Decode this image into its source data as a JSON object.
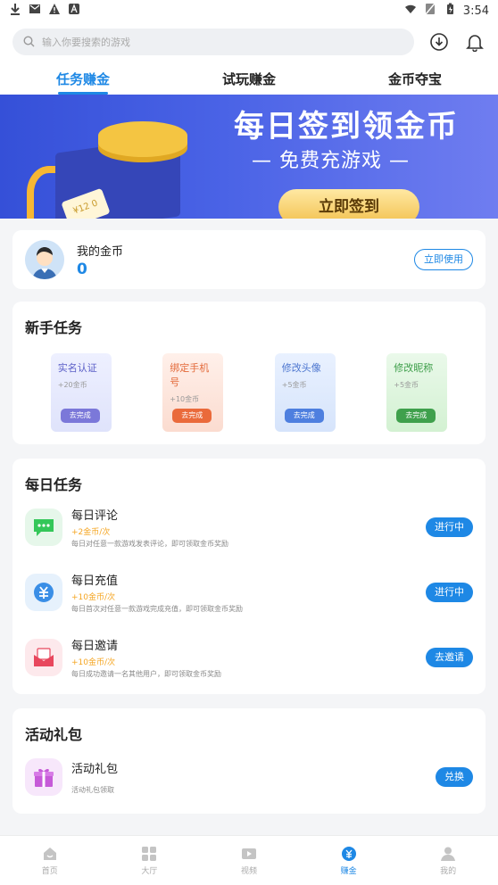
{
  "status_bar": {
    "time": "3:54"
  },
  "search": {
    "placeholder": "输入你要搜索的游戏"
  },
  "tabs": [
    {
      "label": "任务赚金"
    },
    {
      "label": "试玩赚金"
    },
    {
      "label": "金币夺宝"
    }
  ],
  "banner": {
    "title": "每日签到领金币",
    "subtitle": "— 免费充游戏 —",
    "cta": "立即签到",
    "ticket_text": "¥12 0"
  },
  "coins": {
    "label": "我的金币",
    "value": "0",
    "button": "立即使用"
  },
  "newbie": {
    "title": "新手任务",
    "items": [
      {
        "title": "实名认证",
        "reward": "+20金币",
        "button": "去完成"
      },
      {
        "title": "绑定手机号",
        "reward": "+10金币",
        "button": "去完成"
      },
      {
        "title": "修改头像",
        "reward": "+5金币",
        "button": "去完成"
      },
      {
        "title": "修改昵称",
        "reward": "+5金币",
        "button": "去完成"
      }
    ]
  },
  "daily": {
    "title": "每日任务",
    "items": [
      {
        "name": "每日评论",
        "reward": "+2金币/次",
        "desc": "每日对任意一款游戏发表评论，即可领取金币奖励",
        "button": "进行中"
      },
      {
        "name": "每日充值",
        "reward": "+10金币/次",
        "desc": "每日首次对任意一款游戏完成充值，即可领取金币奖励",
        "button": "进行中"
      },
      {
        "name": "每日邀请",
        "reward": "+10金币/次",
        "desc": "每日成功邀请一名其他用户，即可领取金币奖励",
        "button": "去邀请"
      }
    ]
  },
  "gift": {
    "title": "活动礼包",
    "items": [
      {
        "name": "活动礼包",
        "desc": "活动礼包领取",
        "button": "兑换"
      }
    ]
  },
  "tabbar": [
    {
      "label": "首页"
    },
    {
      "label": "大厅"
    },
    {
      "label": "视频"
    },
    {
      "label": "赚金"
    },
    {
      "label": "我的"
    }
  ],
  "colors": {
    "accent": "#1e88e5",
    "reward": "#f5a623",
    "banner": "#4a63e6"
  }
}
